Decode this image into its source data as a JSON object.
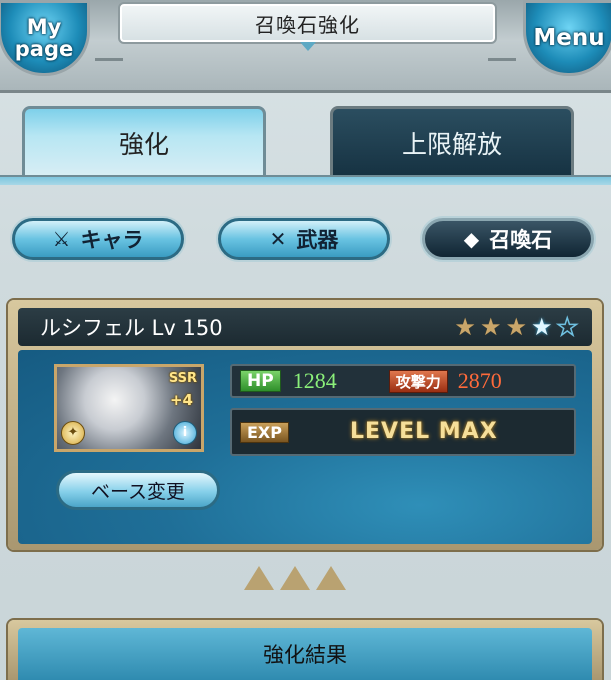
{
  "header": {
    "title": "召喚石強化",
    "mypage_label": "My page",
    "menu_label": "Menu"
  },
  "tabs": [
    {
      "label": "強化",
      "active": true
    },
    {
      "label": "上限解放",
      "active": false
    }
  ],
  "categories": [
    {
      "label": "キャラ",
      "icon": "character-icon",
      "active": false
    },
    {
      "label": "武器",
      "icon": "weapon-icon",
      "active": false
    },
    {
      "label": "召喚石",
      "icon": "summon-crystal-icon",
      "active": true
    }
  ],
  "summon": {
    "name_level": "ルシフェル Lv 150",
    "rarity": "SSR",
    "plus": "+4",
    "stars_filled": 3,
    "stars_total": 5,
    "stars_transcended": 1,
    "hp_label": "HP",
    "hp_value": "1284",
    "atk_label": "攻撃力",
    "atk_value": "2870",
    "exp_label": "EXP",
    "exp_status": "LEVEL MAX",
    "base_change_label": "ベース変更"
  },
  "result": {
    "label": "強化結果"
  },
  "colors": {
    "accent_blue": "#3a9cc2",
    "hp_green": "#8bf07a",
    "atk_orange": "#ff6a3a",
    "gold": "#c9a66a"
  }
}
